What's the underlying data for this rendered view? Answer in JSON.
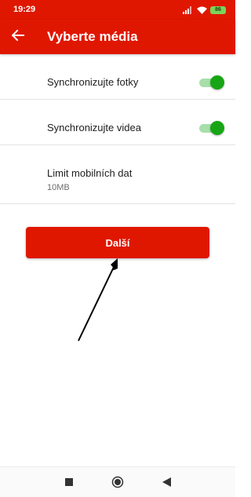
{
  "status_bar": {
    "time": "19:29",
    "battery": "86",
    "icons": [
      "signal-icon",
      "wifi-icon",
      "battery-icon"
    ]
  },
  "app_bar": {
    "back_icon": "arrow-back-icon",
    "title": "Vyberte média"
  },
  "settings": {
    "sync_photos": {
      "label": "Synchronizujte fotky",
      "enabled": true
    },
    "sync_videos": {
      "label": "Synchronizujte videa",
      "enabled": true
    },
    "mobile_data_limit": {
      "label": "Limit mobilních dat",
      "value": "10MB"
    }
  },
  "next_button": {
    "label": "Další"
  },
  "nav_bar": {
    "icons": [
      "square-recents-icon",
      "circle-home-icon",
      "triangle-back-icon"
    ]
  },
  "colors": {
    "accent": "#e01700",
    "switch_on_thumb": "#18a515",
    "switch_on_track": "#a8dfa9",
    "battery": "#7bd35a"
  }
}
